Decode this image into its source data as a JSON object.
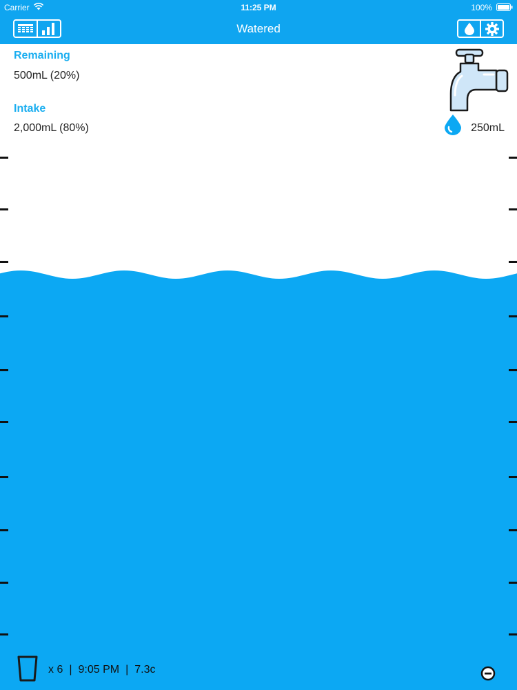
{
  "status": {
    "carrier": "Carrier",
    "time": "11:25 PM",
    "battery": "100%"
  },
  "nav": {
    "title": "Watered"
  },
  "remaining": {
    "label": "Remaining",
    "value": "500mL (20%)"
  },
  "intake": {
    "label": "Intake",
    "value": "2,000mL (80%)",
    "fill_fraction": 0.8
  },
  "serving": {
    "value": "250mL"
  },
  "summary": {
    "count": "x 6",
    "separator": "|",
    "last_time": "9:05 PM",
    "cups": "7.3c"
  },
  "colors": {
    "accent": "#0fa5f0",
    "water": "#0ca8f3",
    "label": "#1aaef0"
  },
  "icons": {
    "log": "grid-icon",
    "stats": "bar-chart-icon",
    "drink": "water-drop-icon",
    "settings": "gear-icon",
    "faucet": "faucet-icon",
    "cup": "glass-icon",
    "remove": "minus-circle-icon"
  }
}
